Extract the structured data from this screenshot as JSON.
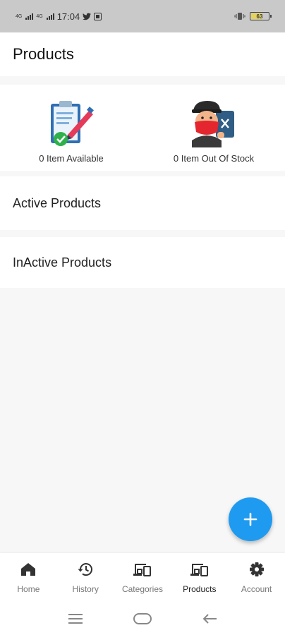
{
  "status_bar": {
    "net_labels": [
      "4G",
      "4G"
    ],
    "time": "17:04",
    "battery": "63"
  },
  "header": {
    "title": "Products"
  },
  "stats": {
    "available": {
      "label": "0 Item Available",
      "icon": "clipboard-check-icon"
    },
    "out_of_stock": {
      "label": "0 Item Out Of Stock",
      "icon": "bandit-out-of-stock-icon"
    }
  },
  "sections": {
    "active": "Active Products",
    "inactive": "InActive Products"
  },
  "fab": {
    "icon": "plus-icon",
    "color": "#1e9bf0"
  },
  "bottom_nav": {
    "items": [
      {
        "label": "Home",
        "icon": "home-icon"
      },
      {
        "label": "History",
        "icon": "history-icon"
      },
      {
        "label": "Categories",
        "icon": "devices-icon"
      },
      {
        "label": "Products",
        "icon": "devices-icon",
        "selected": true
      },
      {
        "label": "Account",
        "icon": "gear-icon"
      }
    ]
  }
}
